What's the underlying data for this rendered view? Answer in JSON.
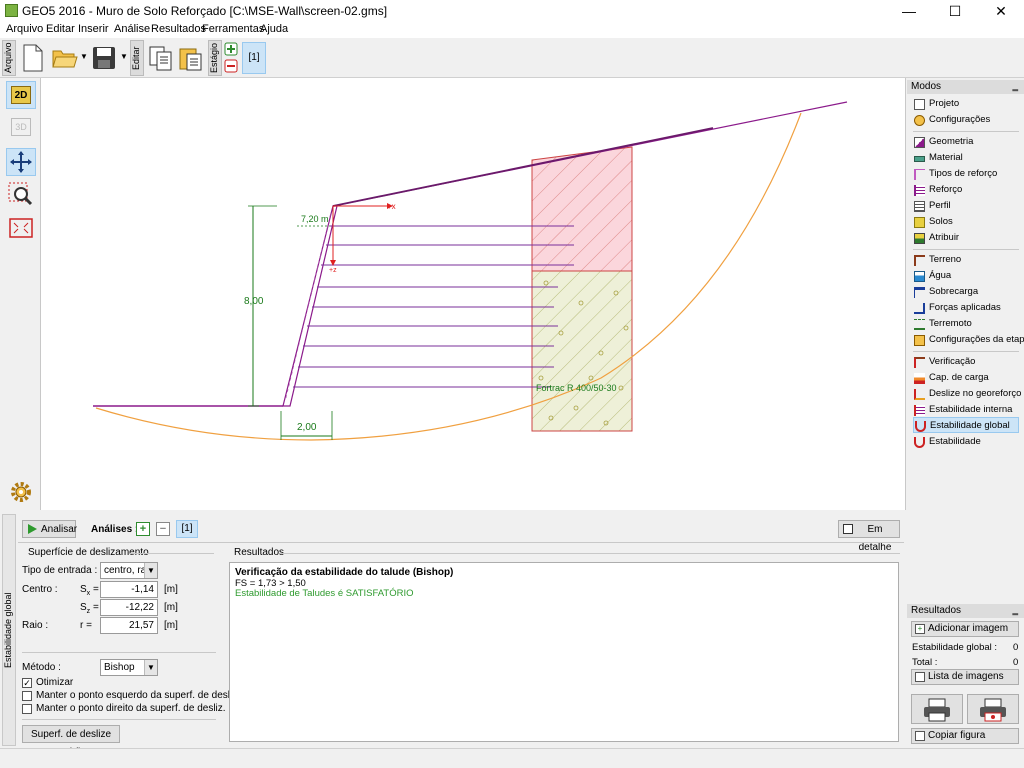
{
  "window": {
    "title": "GEO5 2016 - Muro de Solo Reforçado [C:\\MSE-Wall\\screen-02.gms]",
    "minimize": "—",
    "maximize": "☐",
    "close": "✕"
  },
  "menu": [
    "Arquivo",
    "Editar",
    "Inserir",
    "Análise",
    "Resultados",
    "Ferramentas",
    "Ajuda"
  ],
  "toolbar": {
    "arquivo_label": "Arquivo",
    "editar_label": "Editar",
    "estagio_label": "Estágio",
    "stage": "[1]"
  },
  "lefttools": {
    "btn_2d": "2D",
    "btn_3d": "3D"
  },
  "drawing": {
    "dim_top": "7,20 m",
    "dim_height": "8,00",
    "dim_base": "2,00",
    "axis_x": "+x",
    "axis_z": "+z",
    "reinforcement_label": "Fortrac R 400/50-30"
  },
  "modes": {
    "header": "Modos",
    "groups": [
      [
        "Projeto",
        "Configurações"
      ],
      [
        "Geometria",
        "Material",
        "Tipos de reforço",
        "Reforço",
        "Perfil",
        "Solos",
        "Atribuir"
      ],
      [
        "Terreno",
        "Água",
        "Sobrecarga",
        "Forças aplicadas",
        "Terremoto",
        "Configurações da etapa"
      ],
      [
        "Verificação",
        "Cap. de carga",
        "Deslize no georeforço",
        "Estabilidade interna",
        "Estabilidade global",
        "Estabilidade"
      ]
    ],
    "active": "Estabilidade global"
  },
  "results_panel": {
    "header": "Resultados",
    "add_image": "Adicionar imagem",
    "stab_label": "Estabilidade global :",
    "stab_value": "0",
    "total_label": "Total :",
    "total_value": "0",
    "image_list": "Lista de imagens",
    "copy_figure": "Copiar figura"
  },
  "analysis": {
    "side_label": "Estabilidade global",
    "analyze_button": "Analisar",
    "analyses_label": "Análises :",
    "analysis_tab": "[1]",
    "detail_button": "Em detalhe",
    "slip_surface_title": "Superfície de deslizamento",
    "input_type_label": "Tipo de entrada :",
    "input_type_value": "centro, raio",
    "center_label": "Centro :",
    "sx_label": "S",
    "sx_sub": "x",
    "sx_value": "-1,14",
    "sz_label": "S",
    "sz_sub": "z",
    "sz_value": "-12,22",
    "radius_label": "Raio :",
    "r_label": "r =",
    "r_value": "21,57",
    "unit": "[m]",
    "method_label": "Método :",
    "method_value": "Bishop",
    "optimize_label": "Otimizar",
    "optimize_checked": true,
    "keep_left_label": "Manter o ponto esquerdo da superf. de desliz.",
    "keep_right_label": "Manter o ponto direito da superf. de desliz.",
    "standard_button": "Superf. de deslize padrão",
    "results_title": "Resultados",
    "result_heading": "Verificação da estabilidade do talude (Bishop)",
    "result_fs": "FS = 1,73 > 1,50",
    "result_status": "Estabilidade de Taludes é SATISFATÓRIO",
    "status_color": "#2e9a2e"
  }
}
